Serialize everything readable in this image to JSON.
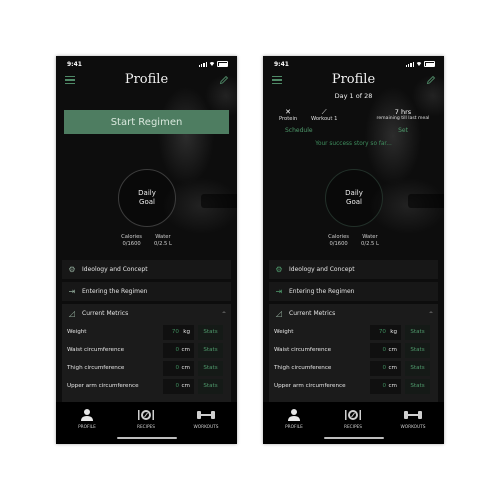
{
  "colors": {
    "accent_green": "#4e7d61",
    "link_green": "#4f9a6c",
    "background": "#0d0d0d"
  },
  "screens": [
    {
      "status_bar": {
        "time": "9:41"
      },
      "header": {
        "title": "Profile",
        "menu_icon": "hamburger-menu-icon",
        "edit_icon": "pencil-icon"
      },
      "start_button": "Start Regimen",
      "daily_goal": {
        "label_line1": "Daily",
        "label_line2": "Goal"
      },
      "stats": [
        {
          "label": "Calories",
          "value": "0/1600"
        },
        {
          "label": "Water",
          "value": "0/2.5 L"
        }
      ],
      "sections": [
        {
          "label": "Ideology and Concept",
          "icon": "gears-icon"
        },
        {
          "label": "Entering the Regimen",
          "icon": "enter-door-icon"
        },
        {
          "label": "Current Metrics",
          "icon": "set-square-icon",
          "expanded": true
        }
      ],
      "metrics": [
        {
          "label": "Weight",
          "value": "70",
          "unit": "kg",
          "action": "Stats"
        },
        {
          "label": "Waist circumference",
          "value": "0",
          "unit": "cm",
          "action": "Stats"
        },
        {
          "label": "Thigh circumference",
          "value": "0",
          "unit": "cm",
          "action": "Stats"
        },
        {
          "label": "Upper arm circumference",
          "value": "0",
          "unit": "cm",
          "action": "Stats"
        }
      ],
      "tabs": [
        {
          "label": "PROFILE",
          "icon": "person-icon",
          "active": true
        },
        {
          "label": "RECIPES",
          "icon": "plate-cutlery-icon",
          "active": false
        },
        {
          "label": "WORKOUTS",
          "icon": "dumbbell-icon",
          "active": false
        }
      ]
    },
    {
      "status_bar": {
        "time": "9:41"
      },
      "header": {
        "title": "Profile",
        "subtitle": "Day 1 of 28",
        "menu_icon": "hamburger-menu-icon",
        "edit_icon": "pencil-icon"
      },
      "schedule": {
        "items": [
          {
            "label": "Protein",
            "icon": "cross-cutlery-icon"
          },
          {
            "label": "Workout 1",
            "icon": "workout-pose-icon"
          }
        ],
        "schedule_link": "Schedule",
        "timer_value": "7 hrs",
        "timer_label": "remaining till last meal",
        "set_link": "Set"
      },
      "success_text": "Your success story so far...",
      "daily_goal": {
        "label_line1": "Daily",
        "label_line2": "Goal"
      },
      "stats": [
        {
          "label": "Calories",
          "value": "0/1600"
        },
        {
          "label": "Water",
          "value": "0/2.5 L"
        }
      ],
      "sections": [
        {
          "label": "Ideology and Concept",
          "icon": "gears-icon"
        },
        {
          "label": "Entering the Regimen",
          "icon": "enter-door-icon"
        },
        {
          "label": "Current Metrics",
          "icon": "set-square-icon",
          "expanded": true
        }
      ],
      "metrics": [
        {
          "label": "Weight",
          "value": "70",
          "unit": "kg",
          "action": "Stats"
        },
        {
          "label": "Waist circumference",
          "value": "0",
          "unit": "cm",
          "action": "Stats"
        },
        {
          "label": "Thigh circumference",
          "value": "0",
          "unit": "cm",
          "action": "Stats"
        },
        {
          "label": "Upper arm circumference",
          "value": "0",
          "unit": "cm",
          "action": "Stats"
        }
      ],
      "tabs": [
        {
          "label": "PROFILE",
          "icon": "person-icon",
          "active": true
        },
        {
          "label": "RECIPES",
          "icon": "plate-cutlery-icon",
          "active": false
        },
        {
          "label": "WORKOUTS",
          "icon": "dumbbell-icon",
          "active": false
        }
      ]
    }
  ]
}
